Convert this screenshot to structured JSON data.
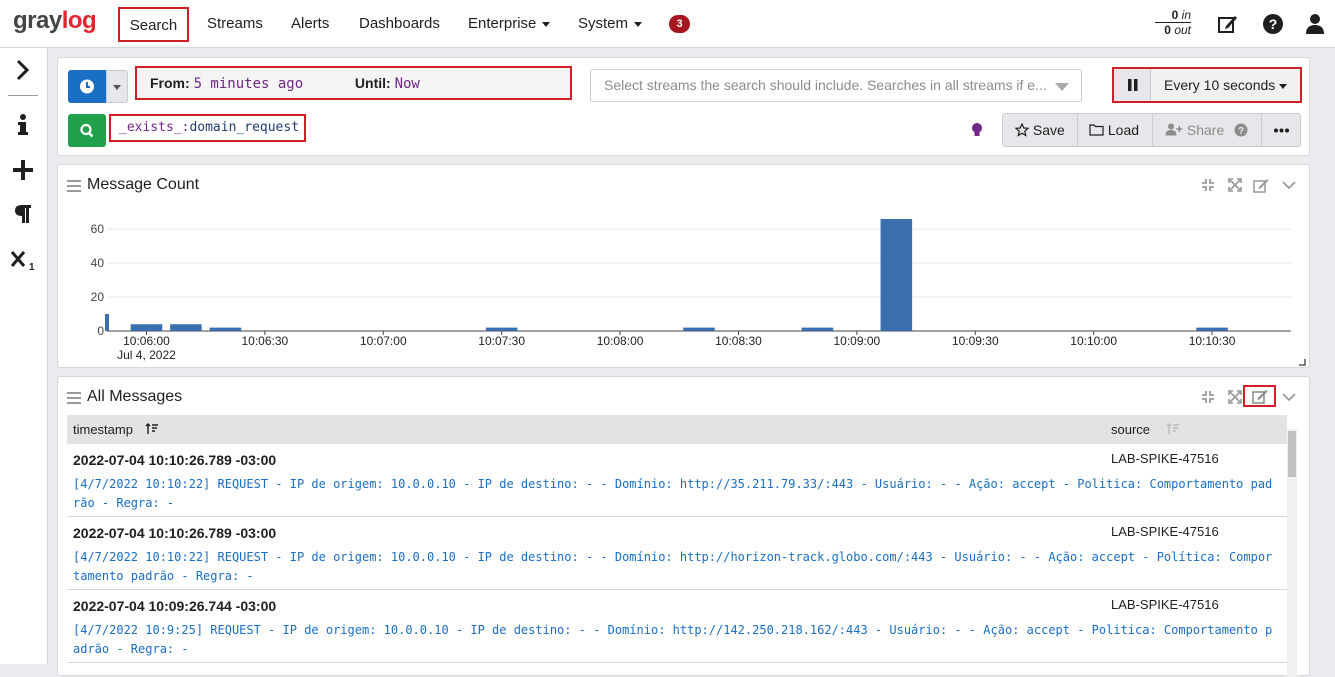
{
  "app": {
    "logo_part1": "gray",
    "logo_part2": "log"
  },
  "nav": {
    "items": [
      "Search",
      "Streams",
      "Alerts",
      "Dashboards",
      "Enterprise",
      "System"
    ],
    "notifications_count": "3"
  },
  "throughput": {
    "in_value": "0",
    "in_label": "in",
    "out_value": "0",
    "out_label": "out"
  },
  "search": {
    "from_label": "From:",
    "from_value": "5 minutes ago",
    "until_label": "Until:",
    "until_value": "Now",
    "streams_placeholder": "Select streams the search should include. Searches in all streams if e...",
    "refresh_label": "Every 10 seconds",
    "query_field": "_exists_:",
    "query_value": "domain_request",
    "save_label": "Save",
    "load_label": "Load",
    "share_label": "Share"
  },
  "message_count": {
    "title": "Message Count",
    "chart_data": {
      "type": "bar",
      "title": "",
      "xlabel": "",
      "ylabel": "",
      "ylim": [
        0,
        66
      ],
      "y_ticks": [
        "0",
        "20",
        "40",
        "60"
      ],
      "x_ticks": [
        "10:06:00",
        "10:06:30",
        "10:07:00",
        "10:07:30",
        "10:08:00",
        "10:08:30",
        "10:09:00",
        "10:09:30",
        "10:10:00",
        "10:10:30"
      ],
      "x_subtitle": "Jul 4, 2022",
      "bars": [
        {
          "time": "10:05:50",
          "value": 10
        },
        {
          "time": "10:06:00",
          "value": 4
        },
        {
          "time": "10:06:10",
          "value": 4
        },
        {
          "time": "10:06:20",
          "value": 2
        },
        {
          "time": "10:07:30",
          "value": 2
        },
        {
          "time": "10:08:20",
          "value": 2
        },
        {
          "time": "10:08:50",
          "value": 2
        },
        {
          "time": "10:09:10",
          "value": 66
        },
        {
          "time": "10:10:30",
          "value": 2
        }
      ]
    }
  },
  "all_messages": {
    "title": "All Messages",
    "columns": [
      "timestamp",
      "source"
    ],
    "rows": [
      {
        "timestamp": "2022-07-04 10:10:26.789 -03:00",
        "source": "LAB-SPIKE-47516",
        "message": "[4/7/2022 10:10:22] REQUEST - IP de origem: 10.0.0.10 - IP de destino: - - Domínio: http://35.211.79.33/:443 - Usuário: - - Ação: accept - Politica: Comportamento padrão - Regra: -"
      },
      {
        "timestamp": "2022-07-04 10:10:26.789 -03:00",
        "source": "LAB-SPIKE-47516",
        "message": "[4/7/2022 10:10:22] REQUEST - IP de origem: 10.0.0.10 - IP de destino: - - Domínio: http://horizon-track.globo.com/:443 - Usuário: - - Ação: accept - Política: Comportamento padrão - Regra: -"
      },
      {
        "timestamp": "2022-07-04 10:09:26.744 -03:00",
        "source": "LAB-SPIKE-47516",
        "message": "[4/7/2022 10:9:25] REQUEST - IP de origem: 10.0.0.10 - IP de destino: - - Domínio: http://142.250.218.162/:443 - Usuário: - - Ação: accept - Politica: Comportamento padrão - Regra: -"
      }
    ]
  },
  "colors": {
    "accent": "#1a6ec3",
    "danger": "#d01f26",
    "success": "#20a14b",
    "bar": "#3c6fb0",
    "query_field": "#702785"
  }
}
